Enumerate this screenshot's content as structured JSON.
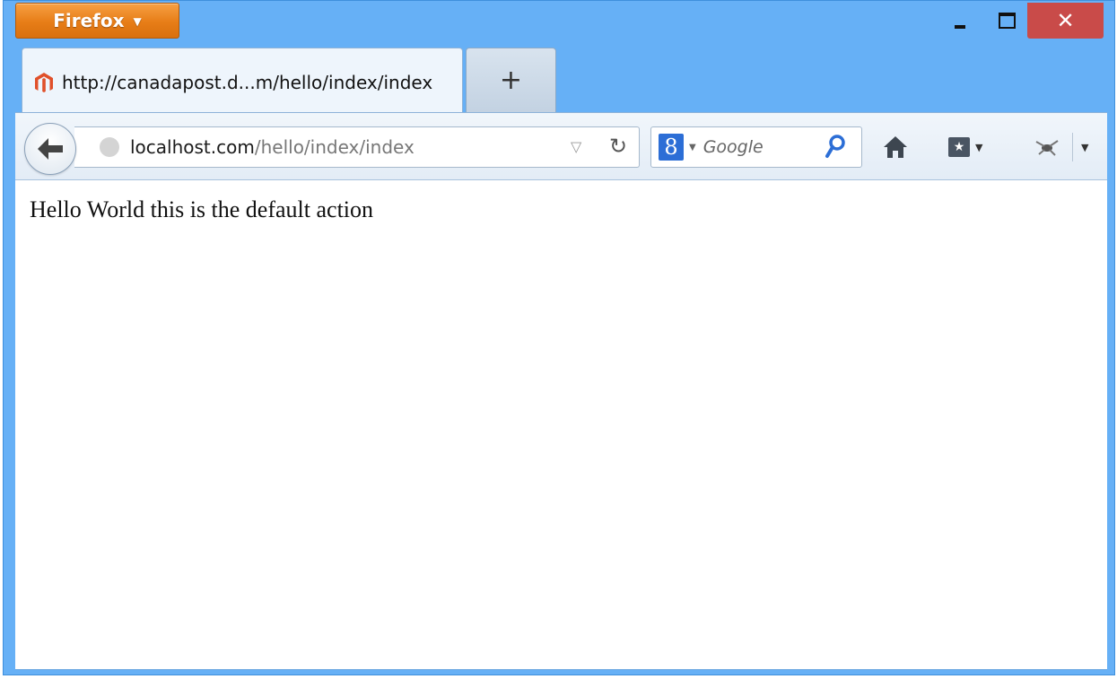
{
  "browser": {
    "app_button_label": "Firefox",
    "tab": {
      "title": "http://canadapost.d...m/hello/index/index"
    },
    "new_tab_label": "+",
    "url": {
      "host": "localhost.com",
      "path": "/hello/index/index"
    },
    "search": {
      "placeholder": "Google"
    },
    "close_glyph": "✕"
  },
  "page": {
    "body_text": "Hello World this is the default action"
  },
  "colors": {
    "frame": "#66b0f6",
    "app_button": "#e77d17",
    "close_button": "#c94b49",
    "magento_icon": "#e0502a"
  },
  "icons": [
    "magento-favicon",
    "back-arrow-icon",
    "globe-icon",
    "dropdown-icon",
    "reload-icon",
    "google-icon",
    "search-icon",
    "home-icon",
    "bookmarks-icon",
    "addon-icon",
    "menu-caret-icon"
  ]
}
